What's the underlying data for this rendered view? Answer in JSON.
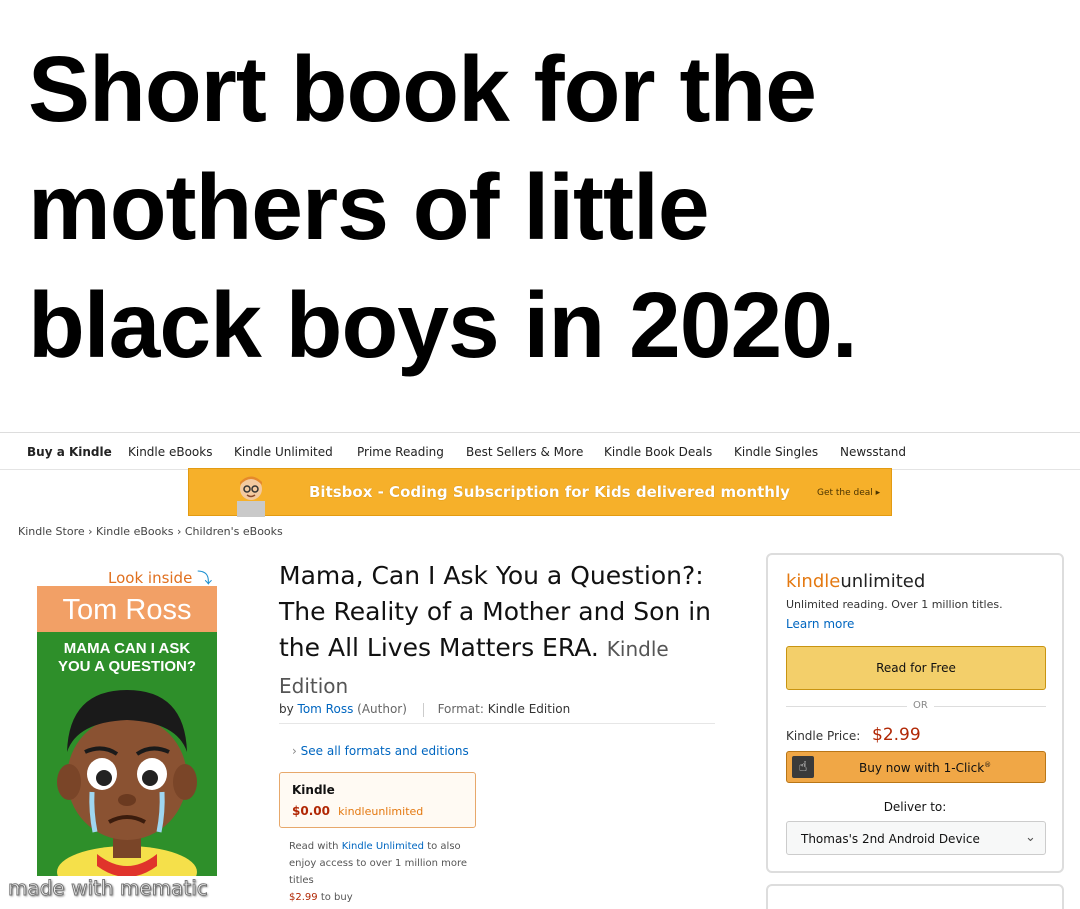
{
  "headline": {
    "lines": [
      "Short book for the",
      "mothers of little",
      "black boys in 2020."
    ]
  },
  "nav": {
    "items": [
      "Buy a Kindle",
      "Kindle eBooks",
      "Kindle Unlimited",
      "Prime Reading",
      "Best Sellers & More",
      "Kindle Book Deals",
      "Kindle Singles",
      "Newsstand"
    ]
  },
  "banner": {
    "text": "Bitsbox - Coding Subscription for Kids delivered monthly",
    "cta": "Get the deal ▸",
    "color": "#f6b02a"
  },
  "breadcrumb": {
    "items": [
      "Kindle Store",
      "Kindle eBooks",
      "Children's eBooks"
    ],
    "separator": "›"
  },
  "cover": {
    "look_inside": "Look inside",
    "look_inside_icon": "down-arrow-icon",
    "author": "Tom Ross",
    "title_lines": [
      "MAMA CAN I ASK",
      "YOU A QUESTION?"
    ]
  },
  "product": {
    "title": "Mama, Can I Ask You a Question?: The Reality of a Mother and Son in the All Lives Matters ERA.",
    "edition": "Kindle Edition",
    "by": "by",
    "author": "Tom Ross",
    "author_role": "(Author)",
    "format_label": "Format:",
    "format_value": "Kindle Edition",
    "see_all": "See all formats and editions",
    "format_box": {
      "name": "Kindle",
      "price": "$0.00",
      "ku_label": "kindleunlimited"
    },
    "read_with": {
      "prefix": "Read with",
      "link": "Kindle Unlimited",
      "rest": "to also enjoy access to over 1 million more titles",
      "price": "$2.99",
      "suffix": "to buy"
    }
  },
  "watermark": "made with mematic",
  "buybox": {
    "ku_logo_k": "kindle",
    "ku_logo_u": "unlimited",
    "ku_desc": "Unlimited reading. Over 1 million titles.",
    "learn_more": "Learn more",
    "read_free": "Read for Free",
    "or": "OR",
    "price_label": "Kindle Price:",
    "price_value": "$2.99",
    "buy_now": "Buy now with 1-Click",
    "buy_now_mark": "®",
    "deliver_to": "Deliver to:",
    "device": "Thomas's 2nd Android Device",
    "accent": "#e47911",
    "price_color": "#b12704"
  }
}
